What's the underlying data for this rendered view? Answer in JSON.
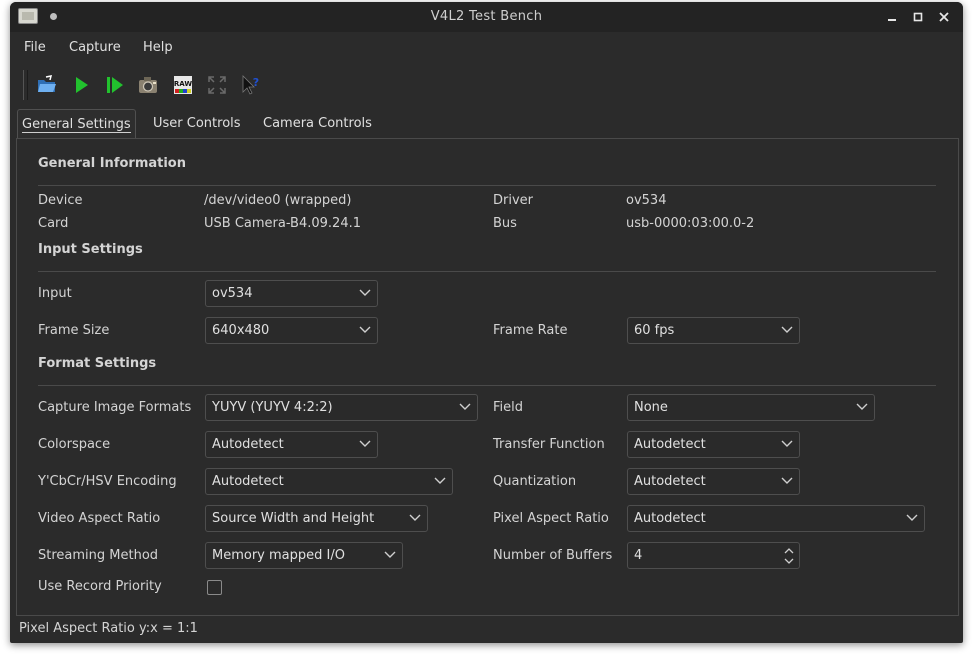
{
  "window": {
    "title": "V4L2 Test Bench"
  },
  "menu": {
    "file": "File",
    "capture": "Capture",
    "help": "Help"
  },
  "toolbar": {
    "icons": [
      "open-icon",
      "play-icon",
      "step-play-icon",
      "camera-icon",
      "raw-icon",
      "fullscreen-icon",
      "whats-this-icon"
    ],
    "raw_label": "RAW"
  },
  "tabs": [
    "General Settings",
    "User Controls",
    "Camera Controls"
  ],
  "general": {
    "section_info": "General Information",
    "device_label": "Device",
    "device_value": "/dev/video0 (wrapped)",
    "driver_label": "Driver",
    "driver_value": "ov534",
    "card_label": "Card",
    "card_value": "USB Camera-B4.09.24.1",
    "bus_label": "Bus",
    "bus_value": "usb-0000:03:00.0-2",
    "section_input": "Input Settings",
    "input_label": "Input",
    "input_value": "ov534",
    "frame_size_label": "Frame Size",
    "frame_size_value": "640x480",
    "frame_rate_label": "Frame Rate",
    "frame_rate_value": "60 fps",
    "section_format": "Format Settings",
    "capture_formats_label": "Capture Image Formats",
    "capture_formats_value": "YUYV (YUYV 4:2:2)",
    "field_label": "Field",
    "field_value": "None",
    "colorspace_label": "Colorspace",
    "colorspace_value": "Autodetect",
    "transfer_label": "Transfer Function",
    "transfer_value": "Autodetect",
    "encoding_label": "Y'CbCr/HSV Encoding",
    "encoding_value": "Autodetect",
    "quantization_label": "Quantization",
    "quantization_value": "Autodetect",
    "video_aspect_label": "Video Aspect Ratio",
    "video_aspect_value": "Source Width and Height",
    "pixel_aspect_label": "Pixel Aspect Ratio",
    "pixel_aspect_value": "Autodetect",
    "streaming_label": "Streaming Method",
    "streaming_value": "Memory mapped I/O",
    "buffers_label": "Number of Buffers",
    "buffers_value": "4",
    "record_priority_label": "Use Record Priority",
    "record_priority_checked": false
  },
  "status": {
    "text": "Pixel Aspect Ratio y:x = 1:1"
  },
  "colors": {
    "window_bg": "#2b2b2b",
    "titlebar_bg": "#232323",
    "text": "#d4d4d4",
    "play_green": "#22c22e"
  }
}
